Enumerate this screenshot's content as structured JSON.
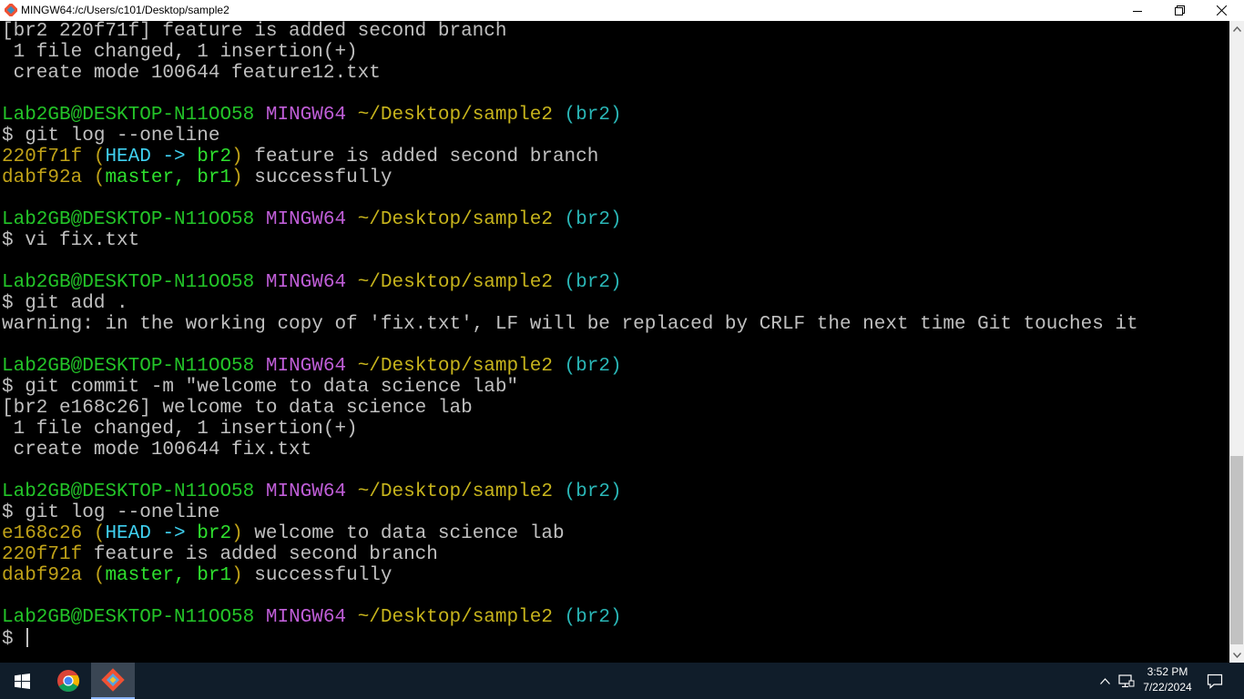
{
  "window": {
    "title": "MINGW64:/c/Users/c101/Desktop/sample2"
  },
  "prompt": {
    "user": "Lab2GB@DESKTOP-N11OO58",
    "env": "MINGW64",
    "path": "~/Desktop/sample2",
    "branch": "(br2)"
  },
  "terminal": {
    "l1": "[br2 220f71f] feature is added second branch",
    "l2": " 1 file changed, 1 insertion(+)",
    "l3": " create mode 100644 feature12.txt",
    "cmd1": "$ git log --oneline",
    "log1": {
      "c1_hash": "220f71f",
      "c1_head": "HEAD -> ",
      "c1_br": "br2",
      "c1_msg": " feature is added second branch",
      "c2_hash": "dabf92a",
      "c2_refs": "master, br1",
      "c2_msg": " successfully"
    },
    "cmd2": "$ vi fix.txt",
    "cmd3": "$ git add .",
    "warning": "warning: in the working copy of 'fix.txt', LF will be replaced by CRLF the next time Git touches it",
    "cmd4": "$ git commit -m \"welcome to data science lab\"",
    "c_out1": "[br2 e168c26] welcome to data science lab",
    "c_out2": " 1 file changed, 1 insertion(+)",
    "c_out3": " create mode 100644 fix.txt",
    "cmd5": "$ git log --oneline",
    "log2": {
      "c1_hash": "e168c26",
      "c1_head": "HEAD -> ",
      "c1_br": "br2",
      "c1_msg": " welcome to data science lab",
      "c2_line": "220f71f",
      "c2_msg": " feature is added second branch",
      "c3_hash": "dabf92a",
      "c3_refs": "master, br1",
      "c3_msg": " successfully"
    },
    "last_prompt": "$ "
  },
  "taskbar": {
    "time": "3:52 PM",
    "date": "7/22/2024",
    "apps": [
      "Google Chrome",
      "Git Bash"
    ]
  },
  "colors": {
    "terminal_bg": "#000000",
    "user_green": "#23c428",
    "env_purple": "#c05ed8",
    "path_yellow": "#c7b41c",
    "branch_cyan": "#2ab6b6",
    "taskbar_bg": "#101d2a"
  }
}
